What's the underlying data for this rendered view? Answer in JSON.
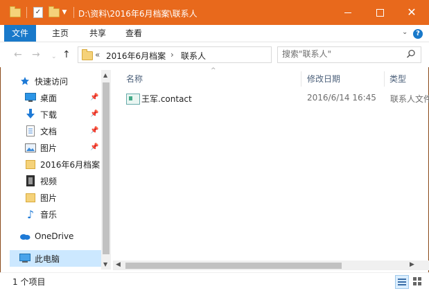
{
  "window": {
    "title": "D:\\资料\\2016年6月档案\\联系人",
    "accent": "#e8691c",
    "controls": {
      "minimize": "",
      "maximize": "",
      "close": "✕"
    }
  },
  "ribbon": {
    "tabs": [
      {
        "label": "文件"
      },
      {
        "label": "主页"
      },
      {
        "label": "共享"
      },
      {
        "label": "查看"
      }
    ],
    "file_tab_color": "#1979ca",
    "help": "?"
  },
  "address": {
    "overflow": "«",
    "crumbs": [
      "2016年6月档案",
      "联系人"
    ],
    "separator": "›"
  },
  "search": {
    "placeholder": "搜索\"联系人\""
  },
  "nav": {
    "items": [
      {
        "label": "快速访问",
        "icon": "star-icon",
        "pinned": false
      },
      {
        "label": "桌面",
        "icon": "desktop-icon",
        "pinned": true
      },
      {
        "label": "下载",
        "icon": "download-icon",
        "pinned": true
      },
      {
        "label": "文档",
        "icon": "document-icon",
        "pinned": true
      },
      {
        "label": "图片",
        "icon": "pictures-icon",
        "pinned": true
      },
      {
        "label": "2016年6月档案",
        "icon": "folder-icon",
        "pinned": false
      },
      {
        "label": "视频",
        "icon": "video-icon",
        "pinned": false
      },
      {
        "label": "图片",
        "icon": "folder-icon",
        "pinned": false
      },
      {
        "label": "音乐",
        "icon": "music-icon",
        "pinned": false
      },
      {
        "label": "OneDrive",
        "icon": "onedrive-icon",
        "pinned": false
      },
      {
        "label": "此电脑",
        "icon": "computer-icon",
        "pinned": false
      }
    ]
  },
  "files": {
    "columns": {
      "name": "名称",
      "date": "修改日期",
      "type": "类型"
    },
    "rows": [
      {
        "name": "王军.contact",
        "date": "2016/6/14 16:45",
        "type": "联系人文件"
      }
    ]
  },
  "status": {
    "text": "1 个项目"
  }
}
